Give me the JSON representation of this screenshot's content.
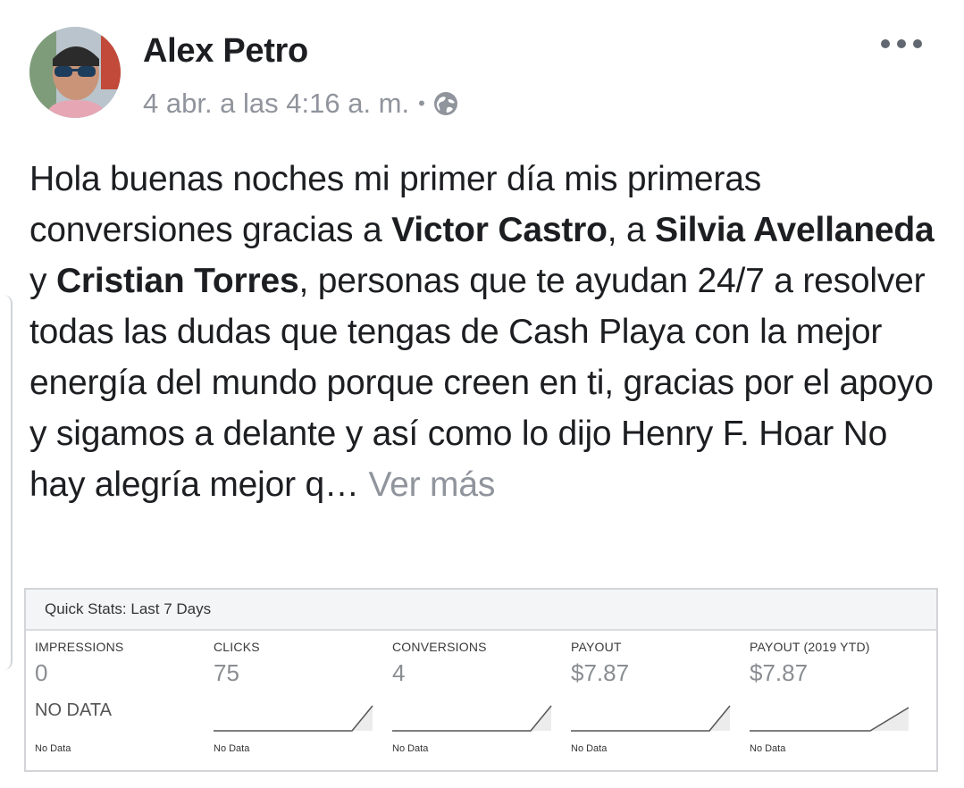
{
  "post": {
    "author": "Alex Petro",
    "timestamp": "4 abr. a las 4:16 a. m.",
    "separator": "•",
    "privacy_icon": "globe-icon",
    "more_icon": "more-horizontal-icon",
    "text": {
      "p1": "Hola buenas noches mi primer día mis primeras conversiones gracias a ",
      "m1": "Victor Castro",
      "p2": ", a ",
      "m2": "Silvia Avellaneda",
      "p3": " y ",
      "m3": "Cristian Torres",
      "p4": ", personas que te ayudan 24/7 a resolver todas las dudas que tengas de Cash Playa con la mejor energía del mundo porque creen en ti, gracias por el apoyo y sigamos a delante y así como lo dijo Henry F. Hoar No hay alegría mejor q… ",
      "see_more": "Ver más"
    }
  },
  "stats": {
    "title": "Quick Stats: Last 7 Days",
    "columns": [
      {
        "label": "IMPRESSIONS",
        "value": "0",
        "nodata_big": "NO DATA",
        "footer": "No Data"
      },
      {
        "label": "CLICKS",
        "value": "75",
        "footer": "No Data"
      },
      {
        "label": "CONVERSIONS",
        "value": "4",
        "footer": "No Data"
      },
      {
        "label": "PAYOUT",
        "value": "$7.87",
        "footer": "No Data"
      },
      {
        "label": "PAYOUT (2019 YTD)",
        "value": "$7.87",
        "footer": "No Data"
      }
    ]
  },
  "colors": {
    "text": "#1c1e21",
    "secondary": "#90949c",
    "border": "#d2d4d7"
  }
}
